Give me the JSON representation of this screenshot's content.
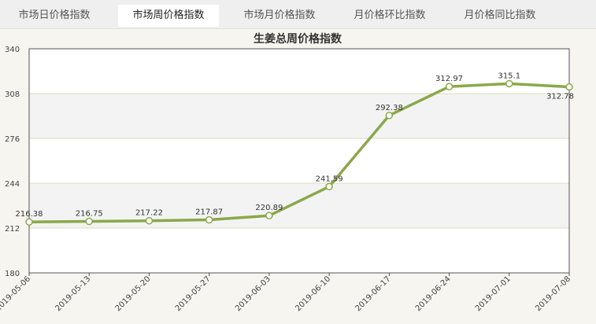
{
  "tabs": [
    {
      "label": "市场日价格指数",
      "active": false
    },
    {
      "label": "市场周价格指数",
      "active": true
    },
    {
      "label": "市场月价格指数",
      "active": false
    },
    {
      "label": "月价格环比指数",
      "active": false
    },
    {
      "label": "月价格同比指数",
      "active": false
    }
  ],
  "colors": {
    "line": "#8ba84a",
    "band": "#f3f3f3",
    "grid": "#dcdcc0",
    "axis": "#555555"
  },
  "chart_data": {
    "type": "line",
    "title": "生姜总周价格指数",
    "xlabel": "",
    "ylabel": "",
    "ylim": [
      180,
      340
    ],
    "yticks": [
      180,
      212,
      244,
      276,
      308,
      340
    ],
    "x": [
      "2019-05-06",
      "2019-05-13",
      "2019-05-20",
      "2019-05-27",
      "2019-06-03",
      "2019-06-10",
      "2019-06-17",
      "2019-06-24",
      "2019-07-01",
      "2019-07-08"
    ],
    "series": [
      {
        "values": [
          216.38,
          216.75,
          217.22,
          217.87,
          220.89,
          241.59,
          292.38,
          312.97,
          315.1,
          312.78
        ],
        "labels": [
          "216.38",
          "216.75",
          "217.22",
          "217.87",
          "220.89",
          "241.59",
          "292.38",
          "312.97",
          "315.1",
          "312.78"
        ]
      }
    ],
    "grid": true,
    "legend": "none"
  }
}
